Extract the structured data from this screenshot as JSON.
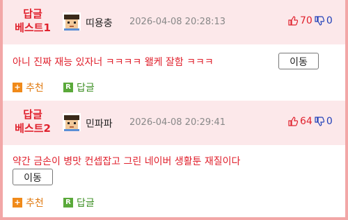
{
  "colors": {
    "accent_red": "#e0212d",
    "vote_down_blue": "#1f3fb8",
    "header_bg": "#fce8ea",
    "border_pink": "#f2a7a7",
    "recommend_orange": "#f08a1a",
    "reply_green": "#5aa93a"
  },
  "comments": [
    {
      "badge_line1": "답글",
      "badge_line2": "베스트1",
      "author": "띠용충",
      "date": "2026-04-08 20:28:13",
      "upvotes": "70",
      "downvotes": "0",
      "text": "아니 진짜 재능 있자너 ㅋㅋㅋㅋ 왤케 잘함 ㅋㅋㅋ",
      "move_label": "이동",
      "recommend_label": "추천",
      "recommend_icon": "+",
      "reply_label": "답글",
      "reply_icon": "R"
    },
    {
      "badge_line1": "답글",
      "badge_line2": "베스트2",
      "author": "민파파",
      "date": "2026-04-08 20:29:41",
      "upvotes": "64",
      "downvotes": "0",
      "text": "약간 금손이 병맛 컨셉잡고 그린 네이버 생활툰 재질이다",
      "move_label": "이동",
      "recommend_label": "추천",
      "recommend_icon": "+",
      "reply_label": "답글",
      "reply_icon": "R"
    }
  ]
}
